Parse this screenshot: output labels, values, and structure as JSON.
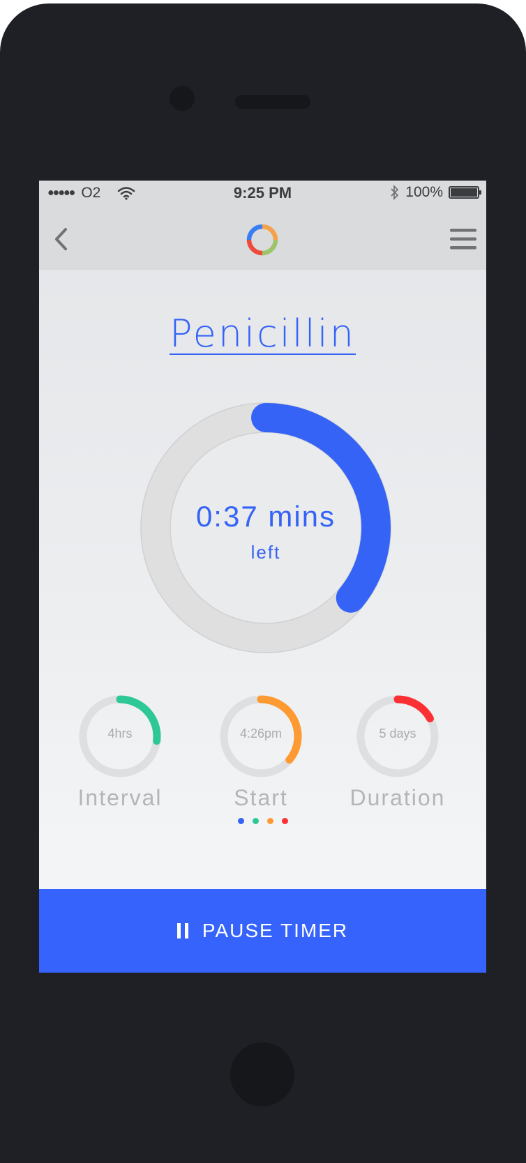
{
  "statusbar": {
    "carrier": "O2",
    "time": "9:25 PM",
    "battery": "100%",
    "icons": [
      "signal-dots-icon",
      "wifi-icon",
      "bluetooth-icon",
      "battery-icon"
    ]
  },
  "navbar": {
    "icons": [
      "back-chevron-icon",
      "app-logo-ring-icon",
      "hamburger-menu-icon"
    ]
  },
  "medication": {
    "name": "Penicillin"
  },
  "timer": {
    "value": "0:37 mins",
    "unit": "left",
    "progress": 0.36,
    "color": "#3563f6"
  },
  "stats": [
    {
      "value": "4hrs",
      "label": "Interval",
      "progress": 0.27,
      "color": "#2ec796"
    },
    {
      "value": "4:26pm",
      "label": "Start",
      "progress": 0.36,
      "color": "#fd9a32"
    },
    {
      "value": "5 days",
      "label": "Duration",
      "progress": 0.17,
      "color": "#fb3034"
    }
  ],
  "pagination": {
    "colors": [
      "#3563f6",
      "#2ec796",
      "#fd9a32",
      "#fb3034"
    ]
  },
  "action": {
    "label": "PAUSE TIMER",
    "icon": "pause-icon",
    "color": "#3563fc"
  }
}
